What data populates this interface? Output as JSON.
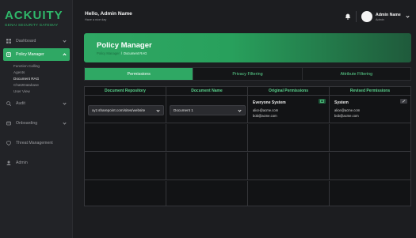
{
  "brand": {
    "name": "ACKUITY",
    "tagline": "GENAI SECURITY GATEWAY"
  },
  "sidebar": {
    "items": [
      {
        "label": "Dashboard",
        "icon": "grid-icon",
        "has_chevron": true
      },
      {
        "label": "Policy Manager",
        "icon": "policy-icon",
        "has_chevron": true,
        "active": true,
        "children": [
          "Function Calling",
          "Agents",
          "Document RAG",
          "Chat2Database",
          "User View"
        ]
      },
      {
        "label": "Audit",
        "icon": "audit-icon",
        "has_chevron": true
      },
      {
        "label": "Onboarding",
        "icon": "onboarding-icon",
        "has_chevron": true
      },
      {
        "label": "Threat Management",
        "icon": "threat-icon",
        "has_chevron": false
      },
      {
        "label": "Admin",
        "icon": "admin-icon",
        "has_chevron": false
      }
    ],
    "selected_child": "Document RAG"
  },
  "topbar": {
    "greeting": "Hello, Admin Name",
    "greeting_sub": "Have a nice day",
    "user_name": "Admin Name",
    "user_role": "Admin"
  },
  "header": {
    "title": "Policy Manager",
    "breadcrumb": {
      "parent": "Policy Manager",
      "separator": "/",
      "current": "Document RAG"
    }
  },
  "tabs": [
    {
      "label": "Permissions",
      "active": true
    },
    {
      "label": "Privacy Filtering",
      "active": false
    },
    {
      "label": "Attribute Filtering",
      "active": false
    }
  ],
  "table": {
    "columns": [
      "Document Repository",
      "Document Name",
      "Original Permissions",
      "Revised Permissions"
    ],
    "rows": [
      {
        "repository": "xyz.sharepoint.com/sites/website",
        "document": "Document 1",
        "original": {
          "group": "Everyone System",
          "users": [
            "alice@acme.com",
            "bob@acme.com"
          ]
        },
        "revised": {
          "group": "System",
          "users": [
            "alice@acme.com",
            "bob@acme.com"
          ]
        }
      }
    ],
    "empty_rows": 3
  },
  "colors": {
    "accent": "#2fa864",
    "accent_text": "#5ad48d",
    "background": "#1c1d20"
  }
}
